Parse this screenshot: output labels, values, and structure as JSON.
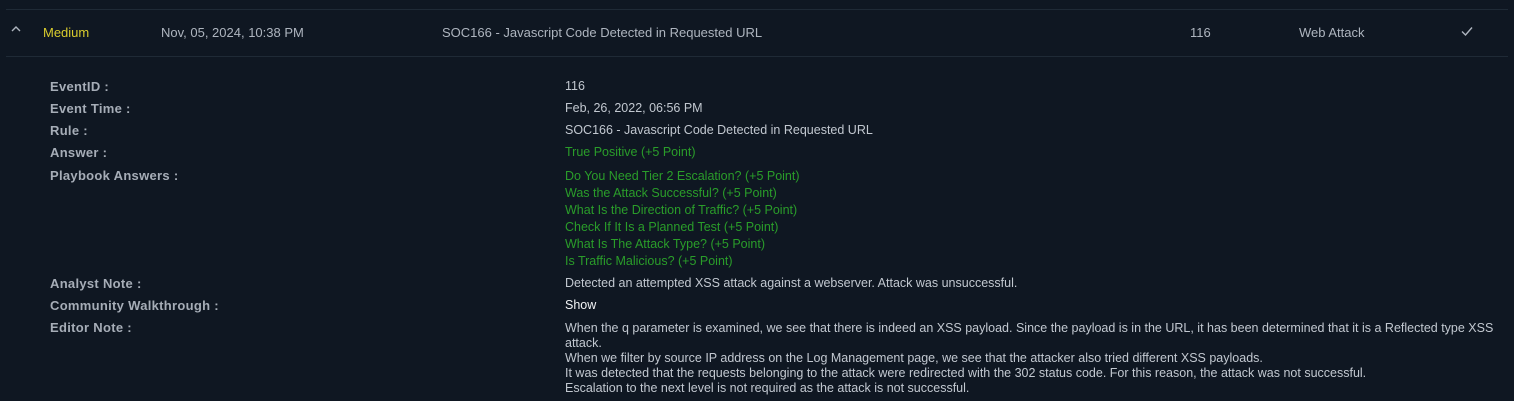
{
  "row": {
    "severity": "Medium",
    "date": "Nov, 05, 2024, 10:38 PM",
    "rule": "SOC166 - Javascript Code Detected in Requested URL",
    "event_id": "116",
    "type": "Web Attack"
  },
  "details": {
    "labels": {
      "event_id": "EventID :",
      "event_time": "Event Time :",
      "rule": "Rule :",
      "answer": "Answer :",
      "playbook": "Playbook Answers :",
      "analyst_note": "Analyst Note :",
      "community": "Community Walkthrough :",
      "editor_note": "Editor Note :"
    },
    "event_id": "116",
    "event_time": "Feb, 26, 2022, 06:56 PM",
    "rule": "SOC166 - Javascript Code Detected in Requested URL",
    "answer": "True Positive (+5 Point)",
    "playbook_answers": [
      "Do You Need Tier 2 Escalation? (+5 Point)",
      "Was the Attack Successful? (+5 Point)",
      "What Is the Direction of Traffic? (+5 Point)",
      "Check If It Is a Planned Test (+5 Point)",
      "What Is The Attack Type? (+5 Point)",
      "Is Traffic Malicious? (+5 Point)"
    ],
    "analyst_note": "Detected an attempted XSS attack against a webserver. Attack was unsuccessful.",
    "community_link": "Show",
    "editor_note": [
      "When the q parameter is examined, we see that there is indeed an XSS payload. Since the payload is in the URL, it has been determined that it is a Reflected type XSS attack.",
      "When we filter by source IP address on the Log Management page, we see that the attacker also tried different XSS payloads.",
      "It was detected that the requests belonging to the attack were redirected with the 302 status code. For this reason, the attack was not successful.",
      "Escalation to the next level is not required as the attack is not successful."
    ]
  },
  "colors": {
    "background": "#0f1722",
    "severity_medium": "#d9cc2e",
    "answer_green": "#2a9d2a"
  },
  "icons": {
    "caret": "chevron-up-icon",
    "check": "check-icon"
  }
}
